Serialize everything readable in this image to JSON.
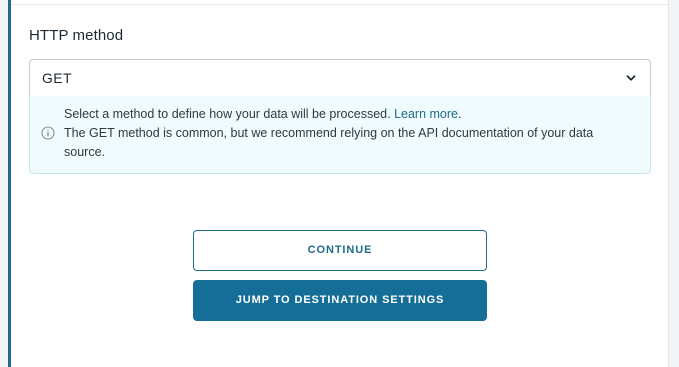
{
  "form": {
    "label": "HTTP method",
    "select": {
      "value": "GET",
      "chevron_icon": "chevron-down-icon"
    },
    "info": {
      "icon": "info-circle-icon",
      "line1": "Select a method to define how your data will be processed.",
      "link": "Learn more",
      "line1_end": ".",
      "line2": "The GET method is common, but we recommend relying on the API documentation of your data source."
    }
  },
  "actions": {
    "continue_label": "CONTINUE",
    "jump_label": "JUMP TO DESTINATION SETTINGS"
  },
  "colors": {
    "accent": "#156e97",
    "info_bg": "#effbfc",
    "panel_border": "#1e6b8c"
  }
}
